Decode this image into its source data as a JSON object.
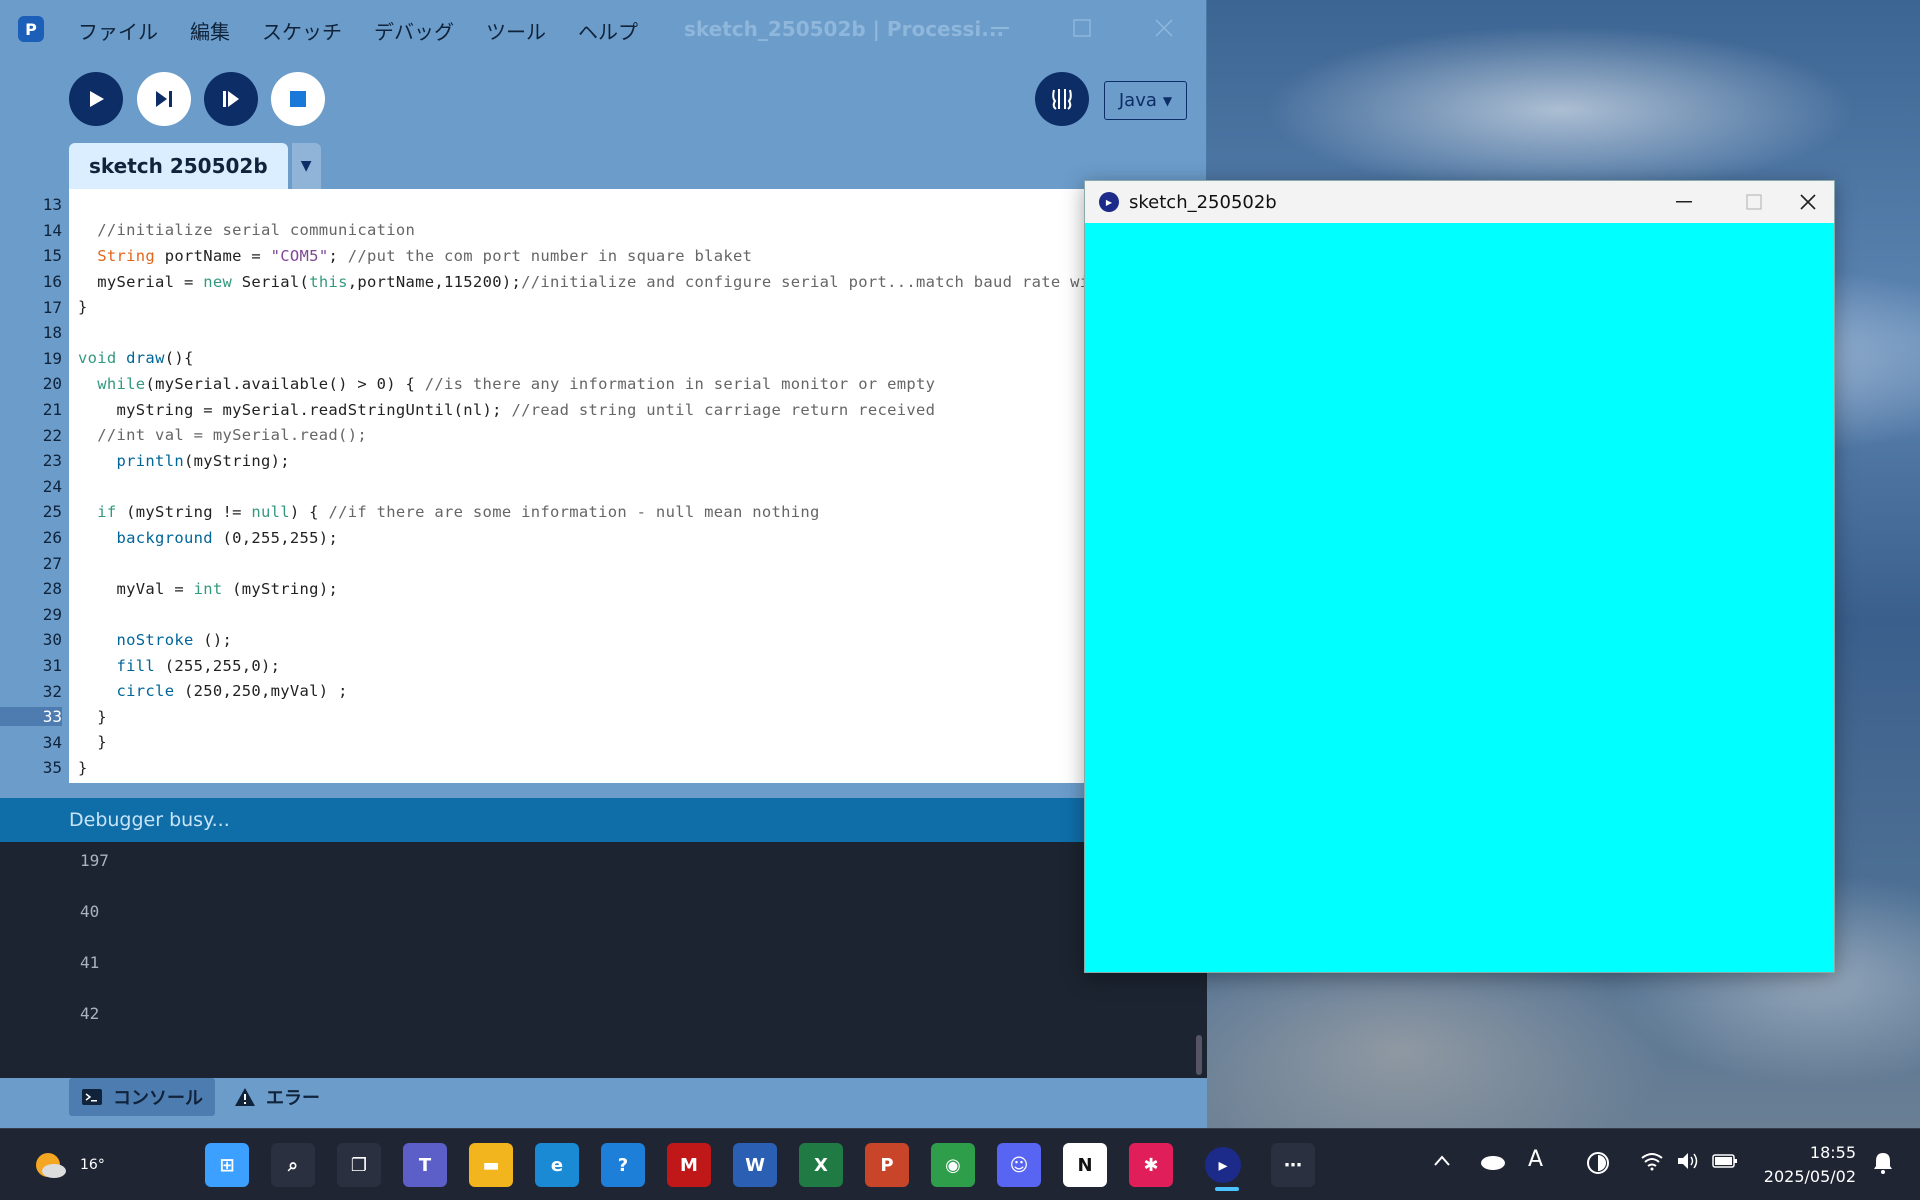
{
  "ide": {
    "logo": "P",
    "menu": [
      "ファイル",
      "編集",
      "スケッチ",
      "デバッグ",
      "ツール",
      "ヘルプ"
    ],
    "title": "sketch_250502b | Processi...",
    "mode": "Java",
    "tab_label": "sketch 250502b",
    "status": "Debugger busy...",
    "console_tab": "コンソール",
    "errors_tab": "エラー"
  },
  "code_lines": [
    {
      "n": "13",
      "text": ""
    },
    {
      "n": "14",
      "text": "  //initialize serial communication"
    },
    {
      "n": "15",
      "text": "  String portName = \"COM5\"; //put the com port number in square blaket"
    },
    {
      "n": "16",
      "text": "  mySerial = new Serial(this,portName,115200);//initialize and configure serial port...match baud rate with xiao"
    },
    {
      "n": "17",
      "text": "}"
    },
    {
      "n": "18",
      "text": ""
    },
    {
      "n": "19",
      "text": "void draw(){"
    },
    {
      "n": "20",
      "text": "  while(mySerial.available() > 0) { //is there any information in serial monitor or empty"
    },
    {
      "n": "21",
      "text": "    myString = mySerial.readStringUntil(nl); //read string until carriage return received"
    },
    {
      "n": "22",
      "text": "  //int val = mySerial.read();"
    },
    {
      "n": "23",
      "text": "    println(myString);"
    },
    {
      "n": "24",
      "text": ""
    },
    {
      "n": "25",
      "text": "  if (myString != null) { //if there are some information - null mean nothing"
    },
    {
      "n": "26",
      "text": "    background (0,255,255);"
    },
    {
      "n": "27",
      "text": ""
    },
    {
      "n": "28",
      "text": "    myVal = int (myString);"
    },
    {
      "n": "29",
      "text": ""
    },
    {
      "n": "30",
      "text": "    noStroke ();"
    },
    {
      "n": "31",
      "text": "    fill (255,255,0);"
    },
    {
      "n": "32",
      "text": "    circle (250,250,myVal) ;"
    },
    {
      "n": "33",
      "text": "  }"
    },
    {
      "n": "34",
      "text": "  }"
    },
    {
      "n": "35",
      "text": "}"
    }
  ],
  "current_line": "33",
  "console_lines": [
    "197",
    "40",
    "41",
    "42"
  ],
  "sketch_window": {
    "title": "sketch_250502b",
    "background": "#00ffff"
  },
  "taskbar": {
    "weather_temp": "16°",
    "time": "18:55",
    "date": "2025/05/02",
    "apps": [
      {
        "name": "start-icon",
        "glyph": "⊞",
        "color": "#3ba0ff"
      },
      {
        "name": "search-icon",
        "glyph": "⌕",
        "color": "#2a3040"
      },
      {
        "name": "task-view-icon",
        "glyph": "❐",
        "color": "#2a3040"
      },
      {
        "name": "teams-icon",
        "glyph": "T",
        "color": "#5b5fc7"
      },
      {
        "name": "file-explorer-icon",
        "glyph": "▬",
        "color": "#f2b51d"
      },
      {
        "name": "edge-icon",
        "glyph": "e",
        "color": "#1a8ad4"
      },
      {
        "name": "help-icon",
        "glyph": "?",
        "color": "#1e7fd8"
      },
      {
        "name": "mcafee-icon",
        "glyph": "M",
        "color": "#c01818"
      },
      {
        "name": "word-icon",
        "glyph": "W",
        "color": "#2b5fb4"
      },
      {
        "name": "excel-icon",
        "glyph": "X",
        "color": "#1f7a44"
      },
      {
        "name": "powerpoint-icon",
        "glyph": "P",
        "color": "#c9452a"
      },
      {
        "name": "chrome-icon",
        "glyph": "◉",
        "color": "#2e9e4a"
      },
      {
        "name": "discord-icon",
        "glyph": "☺",
        "color": "#5865f2"
      },
      {
        "name": "notion-icon",
        "glyph": "N",
        "color": "#ffffff"
      },
      {
        "name": "slack-icon",
        "glyph": "✱",
        "color": "#e01e5a"
      },
      {
        "name": "processing-icon",
        "glyph": "▸",
        "color": "#1c2a8a"
      },
      {
        "name": "more-icon",
        "glyph": "⋯",
        "color": "#2a3040"
      }
    ]
  }
}
